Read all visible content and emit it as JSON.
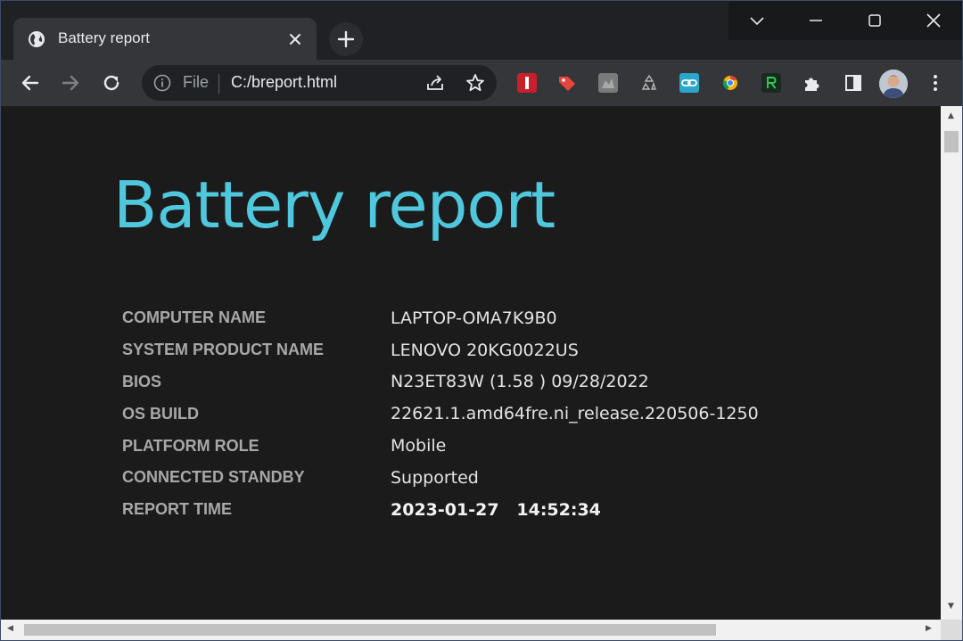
{
  "browser": {
    "tab": {
      "title": "Battery report",
      "favicon": "globe-icon",
      "close_icon": "close-icon"
    },
    "new_tab_icon": "plus-icon",
    "window_controls": [
      "chevron-down-icon",
      "minimize-icon",
      "maximize-icon",
      "close-icon"
    ],
    "toolbar": {
      "back_icon": "arrow-left-icon",
      "forward_icon": "arrow-right-icon",
      "reload_icon": "reload-icon",
      "info_icon": "info-icon",
      "scheme_label": "File",
      "url": "C:/breport.html",
      "share_icon": "share-icon",
      "bookmark_icon": "star-icon",
      "extensions": [
        {
          "name": "extension-red-bookmark-icon",
          "color": "#c8202b"
        },
        {
          "name": "extension-tag-icon",
          "color": "#e8453c"
        },
        {
          "name": "extension-gray-icon",
          "color": "#7a7a7a"
        },
        {
          "name": "extension-recycle-icon",
          "color": "#b0b0b0"
        },
        {
          "name": "extension-link-icon",
          "color": "#2aa7c9"
        },
        {
          "name": "extension-chrome-icon",
          "color": "#f4b400"
        },
        {
          "name": "extension-r-icon",
          "color": "#1e8c3a"
        }
      ],
      "puzzle_icon": "puzzle-icon",
      "sidepanel_icon": "side-panel-icon",
      "profile_icon": "avatar",
      "menu_icon": "more-vertical-icon"
    }
  },
  "report": {
    "title": "Battery report",
    "title_color": "#4fc8dd",
    "rows": [
      {
        "label": "COMPUTER NAME",
        "value": "LAPTOP-OMA7K9B0"
      },
      {
        "label": "SYSTEM PRODUCT NAME",
        "value": "LENOVO 20KG0022US"
      },
      {
        "label": "BIOS",
        "value": "N23ET83W (1.58 ) 09/28/2022"
      },
      {
        "label": "OS BUILD",
        "value": "22621.1.amd64fre.ni_release.220506-1250"
      },
      {
        "label": "PLATFORM ROLE",
        "value": "Mobile"
      },
      {
        "label": "CONNECTED STANDBY",
        "value": "Supported"
      },
      {
        "label": "REPORT TIME",
        "value": "2023-01-27   14:52:34"
      }
    ]
  }
}
